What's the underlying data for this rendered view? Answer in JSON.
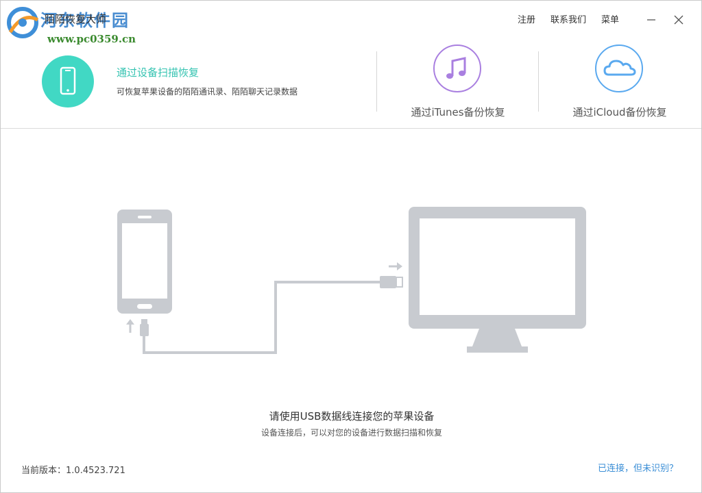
{
  "window": {
    "title": "陌陌恢复大师",
    "watermark_text": "河东软件园",
    "watermark_url": "www.pc0359.cn"
  },
  "top_menu": {
    "register": "注册",
    "contact": "联系我们",
    "menu": "菜单"
  },
  "modes": {
    "scan": {
      "title": "通过设备扫描恢复",
      "description": "可恢复苹果设备的陌陌通讯录、陌陌聊天记录数据",
      "icon": "phone-icon"
    },
    "itunes": {
      "label": "通过iTunes备份恢复",
      "icon": "music-note-icon"
    },
    "icloud": {
      "label": "通过iCloud备份恢复",
      "icon": "cloud-icon"
    }
  },
  "main": {
    "hint_title": "请使用USB数据线连接您的苹果设备",
    "hint_subtitle": "设备连接后，可以对您的设备进行数据扫描和恢复"
  },
  "footer": {
    "version_label": "当前版本：",
    "version_value": "1.0.4523.721",
    "help_link": "已连接，但未识别？"
  },
  "colors": {
    "accent_teal": "#41d8c4",
    "itunes_purple": "#a97fe0",
    "icloud_blue": "#5aa9ef",
    "link_blue": "#3a8ed6",
    "illustration_gray": "#c8cbd0"
  }
}
